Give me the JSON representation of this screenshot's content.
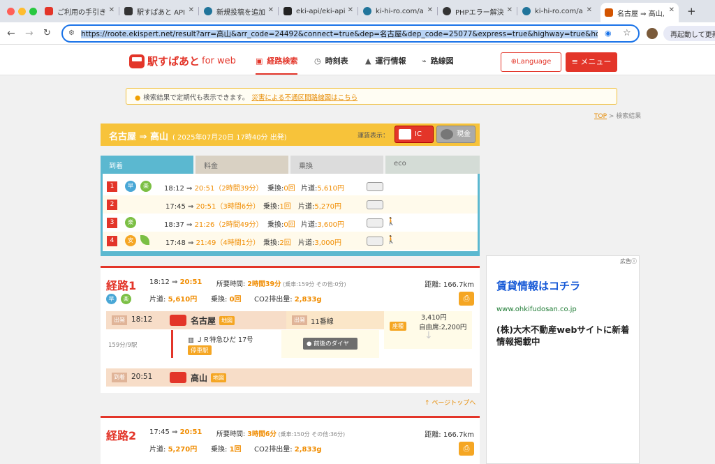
{
  "browser": {
    "tabs": [
      {
        "title": "ご利用の手引き",
        "color": "#e33529"
      },
      {
        "title": "駅すぱあと API",
        "color": "#333333"
      },
      {
        "title": "新規投稿を追加",
        "color": "#21759b"
      },
      {
        "title": "eki-api/eki-api",
        "color": "#222222"
      },
      {
        "title": "ki-hi-ro.com/a",
        "color": "#21759b"
      },
      {
        "title": "PHPエラー解決",
        "color": "#333333"
      },
      {
        "title": "ki-hi-ro.com/a",
        "color": "#21759b"
      },
      {
        "title": "名古屋 ⇒ 高山,",
        "color": "#d35400"
      }
    ],
    "url": "https://roote.ekispert.net/result?arr=高山&arr_code=24492&connect=true&dep=名古屋&dep_code=25077&express=true&highway=true&hour&liner=true",
    "relaunch": "再起動して更新"
  },
  "site": {
    "logo_main": "駅すぱあと",
    "logo_sub": "for web",
    "nav": [
      "経路検索",
      "時刻表",
      "運行情報",
      "路線図"
    ],
    "language": "Language",
    "menu": "メニュー",
    "notice_text": "検索結果で定期代も表示できます。",
    "notice_link": "災害による不通区間路線図はこちら",
    "breadcrumb_top": "TOP",
    "breadcrumb_sep": " > ",
    "breadcrumb_current": "検索結果"
  },
  "summary": {
    "route": "名古屋 ⇒ 高山",
    "datetime": "( 2025年07月20日 17時40分 出発)",
    "fare_label": "運賃表示：",
    "ic": "IC",
    "cash": "現金",
    "tabs": [
      "到着",
      "料金",
      "乗換",
      "eco"
    ],
    "rows": [
      {
        "no": "1",
        "badges": [
          "早",
          "楽"
        ],
        "dep": "18:12 ⇒ ",
        "arr": "20:51",
        "dur": "（2時間39分）",
        "tr_label": "乗換:",
        "tr": "0回",
        "fare_label": "片道:",
        "fare": "5,610円"
      },
      {
        "no": "2",
        "badges": [],
        "dep": "17:45 ⇒ ",
        "arr": "20:51",
        "dur": "（3時間6分）",
        "tr_label": "乗換:",
        "tr": "1回",
        "fare_label": "片道:",
        "fare": "5,270円"
      },
      {
        "no": "3",
        "badges": [
          "楽"
        ],
        "dep": "18:37 ⇒ ",
        "arr": "21:26",
        "dur": "（2時間49分）",
        "tr_label": "乗換:",
        "tr": "0回",
        "fare_label": "片道:",
        "fare": "3,600円"
      },
      {
        "no": "4",
        "badges": [
          "安"
        ],
        "dep": "17:48 ⇒ ",
        "arr": "21:49",
        "dur": "（4時間1分）",
        "tr_label": "乗換:",
        "tr": "2回",
        "fare_label": "片道:",
        "fare": "3,000円"
      }
    ]
  },
  "route1": {
    "title": "経路1",
    "dep": "18:12 ⇒ ",
    "arr": "20:51",
    "dur_label": "所要時間: ",
    "dur": "2時間39分",
    "dur_detail": " (乗車:159分 その他:0分)",
    "dist": "距離: 166.7km",
    "badges": [
      "早",
      "楽"
    ],
    "fare_label": "片道: ",
    "fare": "5,610円",
    "tr_label": "乗換: ",
    "tr": "0回",
    "co2_label": "CO2排出量: ",
    "co2": "2,833g",
    "dep_label": "出発",
    "dep_time": "18:12",
    "dep_station": "名古屋",
    "map": "地図",
    "platform": "11番線",
    "fare1": "3,410円",
    "seat_label": "座種",
    "seat": "自由席:2,200円",
    "count": "159分/9駅",
    "train": "ＪＲ特急ひだ 17号",
    "stops": "停車駅",
    "dia": "前後のダイヤ",
    "arr_label": "到着",
    "arr_time": "20:51",
    "arr_station": "高山",
    "pagetop": "ページトップへ"
  },
  "route2": {
    "title": "経路2",
    "dep": "17:45 ⇒ ",
    "arr": "20:51",
    "dur_label": "所要時間: ",
    "dur": "3時間6分",
    "dur_detail": " (乗車:150分 その他:36分)",
    "dist": "距離: 166.7km",
    "fare_label": "片道: ",
    "fare": "5,270円",
    "tr_label": "乗換: ",
    "tr": "1回",
    "co2_label": "CO2排出量: ",
    "co2": "2,833g"
  },
  "ad": {
    "label": "広告",
    "title": "賃貸情報はコチラ",
    "url": "www.ohkifudosan.co.jp",
    "body": "(株)大木不動産webサイトに新着情報掲載中"
  }
}
